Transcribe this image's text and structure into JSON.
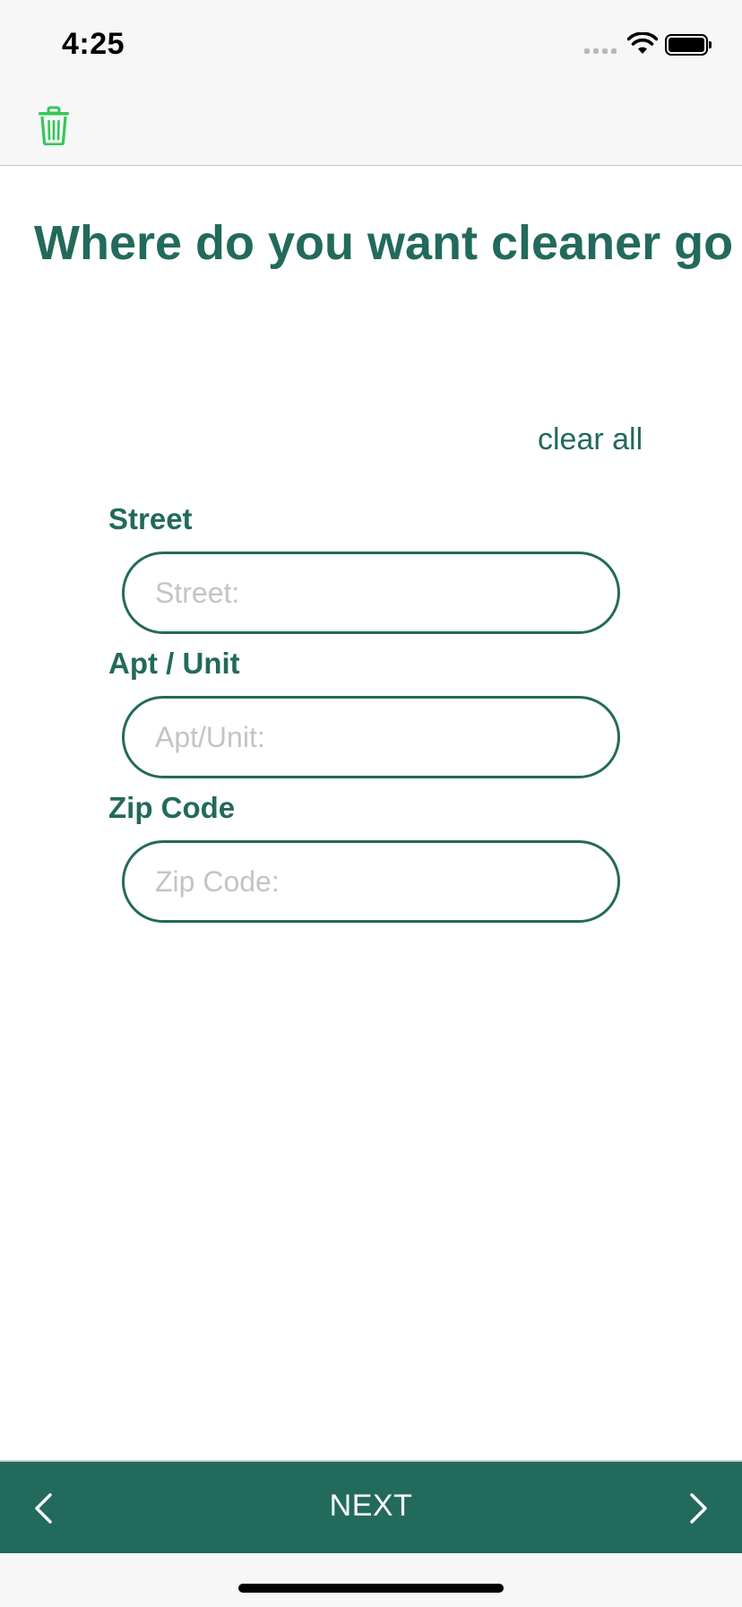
{
  "status_bar": {
    "time": "4:25"
  },
  "nav_bar": {
    "trash_icon": "trash-icon",
    "trash_color": "#34c759"
  },
  "page": {
    "title": "Where do you want cleaner go",
    "clear_all": "clear all"
  },
  "form": {
    "street": {
      "label": "Street",
      "placeholder": "Street:",
      "value": ""
    },
    "apt": {
      "label": "Apt / Unit",
      "placeholder": "Apt/Unit:",
      "value": ""
    },
    "zip": {
      "label": "Zip Code",
      "placeholder": "Zip Code:",
      "value": ""
    }
  },
  "bottom_bar": {
    "next_label": "NEXT",
    "prev_icon": "chevron-left-icon",
    "next_icon": "chevron-right-icon"
  },
  "colors": {
    "accent": "#226a5b",
    "trash": "#34c759",
    "placeholder": "#c4c4c6"
  }
}
